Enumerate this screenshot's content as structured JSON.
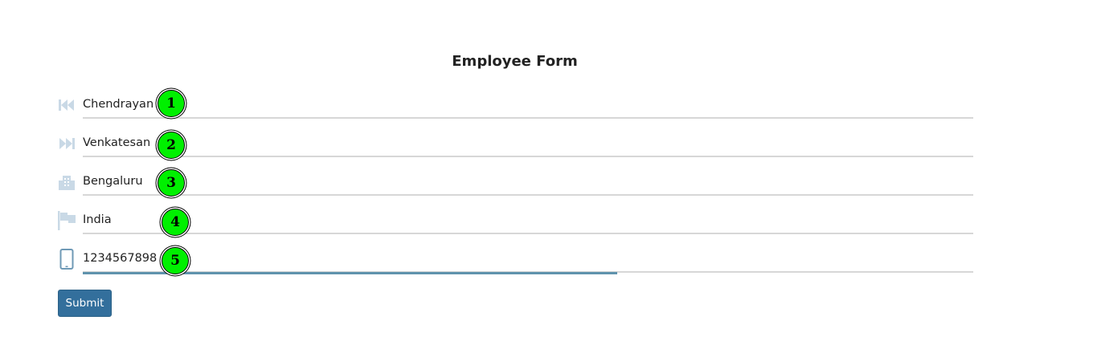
{
  "form": {
    "title": "Employee Form",
    "fields": [
      {
        "value": "Chendrayan",
        "icon": "first-name-icon",
        "marker": "1"
      },
      {
        "value": "Venkatesan",
        "icon": "last-name-icon",
        "marker": "2"
      },
      {
        "value": "Bengaluru",
        "icon": "city-icon",
        "marker": "3"
      },
      {
        "value": "India",
        "icon": "flag-icon",
        "marker": "4"
      },
      {
        "value": "1234567898",
        "icon": "phone-icon",
        "marker": "5"
      }
    ],
    "submit_label": "Submit"
  },
  "colors": {
    "icon": "#c9d9e6",
    "phone_icon": "#6f9ab6",
    "focus_bar": "#5f93ad",
    "submit_bg": "#336f9c",
    "marker_bg": "#00f000"
  }
}
